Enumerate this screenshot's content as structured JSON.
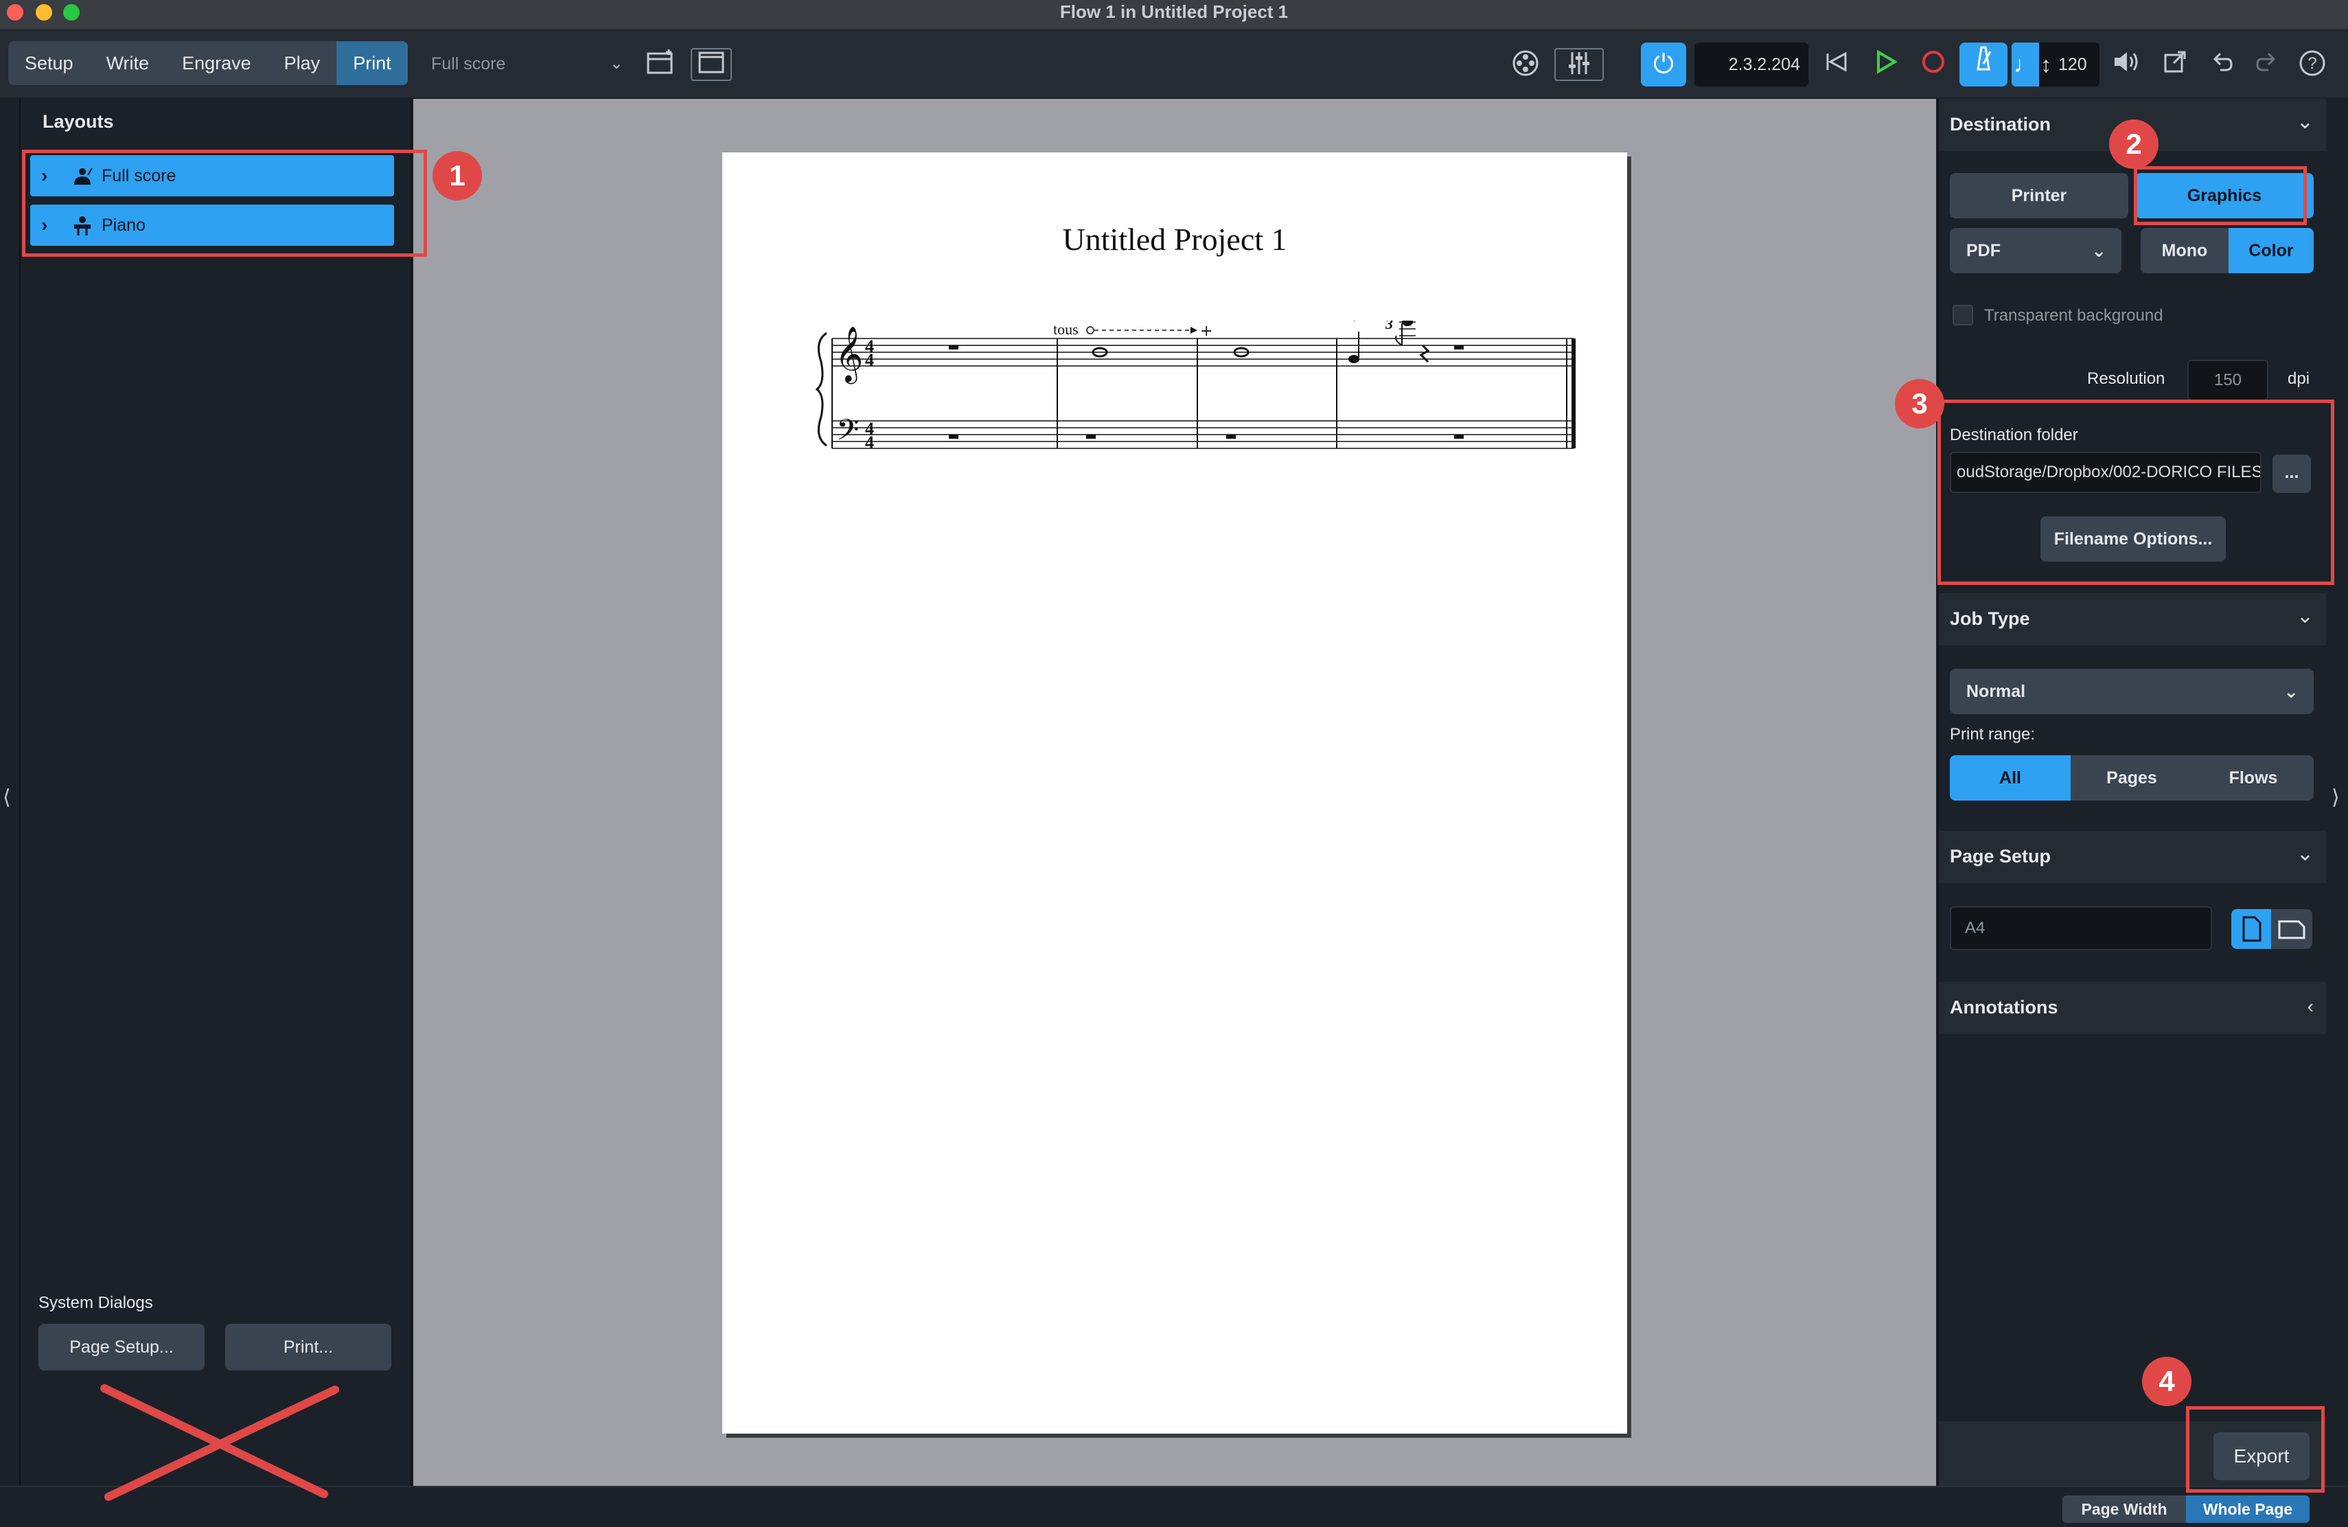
{
  "window": {
    "title": "Flow 1 in Untitled Project 1"
  },
  "toolbar": {
    "modes": [
      "Setup",
      "Write",
      "Engrave",
      "Play",
      "Print"
    ],
    "active_mode": "Print",
    "layout_select": "Full score",
    "time_display": "2.3.2.204",
    "tempo": "120"
  },
  "left_panel": {
    "title": "Layouts",
    "layouts": [
      {
        "label": "Full score",
        "icon": "conductor-icon"
      },
      {
        "label": "Piano",
        "icon": "piano-player-icon"
      }
    ],
    "system_dialogs_label": "System Dialogs",
    "page_setup_button": "Page Setup...",
    "print_button": "Print..."
  },
  "page": {
    "title": "Untitled Project 1",
    "score_text": {
      "tous": "tous",
      "tuplet": "3"
    }
  },
  "destination": {
    "header": "Destination",
    "printer_label": "Printer",
    "graphics_label": "Graphics",
    "format": "PDF",
    "mono_label": "Mono",
    "color_label": "Color",
    "transparent_label": "Transparent background",
    "resolution_label": "Resolution",
    "resolution_value": "150",
    "resolution_unit": "dpi",
    "folder_label": "Destination folder",
    "folder_value": "oudStorage/Dropbox/002-DORICO FILES",
    "browse_label": "...",
    "filename_options": "Filename Options..."
  },
  "job_type": {
    "header": "Job Type",
    "value": "Normal",
    "print_range_label": "Print range:",
    "ranges": [
      "All",
      "Pages",
      "Flows"
    ]
  },
  "page_setup": {
    "header": "Page Setup",
    "paper": "A4"
  },
  "annotations": {
    "header": "Annotations"
  },
  "footer": {
    "export_button": "Export",
    "page_width": "Page Width",
    "whole_page": "Whole Page"
  },
  "badges": [
    "1",
    "2",
    "3",
    "4"
  ],
  "colors": {
    "accent": "#2ea1f2",
    "annotation_red": "#e04848",
    "panel_bg": "#1b2128"
  }
}
